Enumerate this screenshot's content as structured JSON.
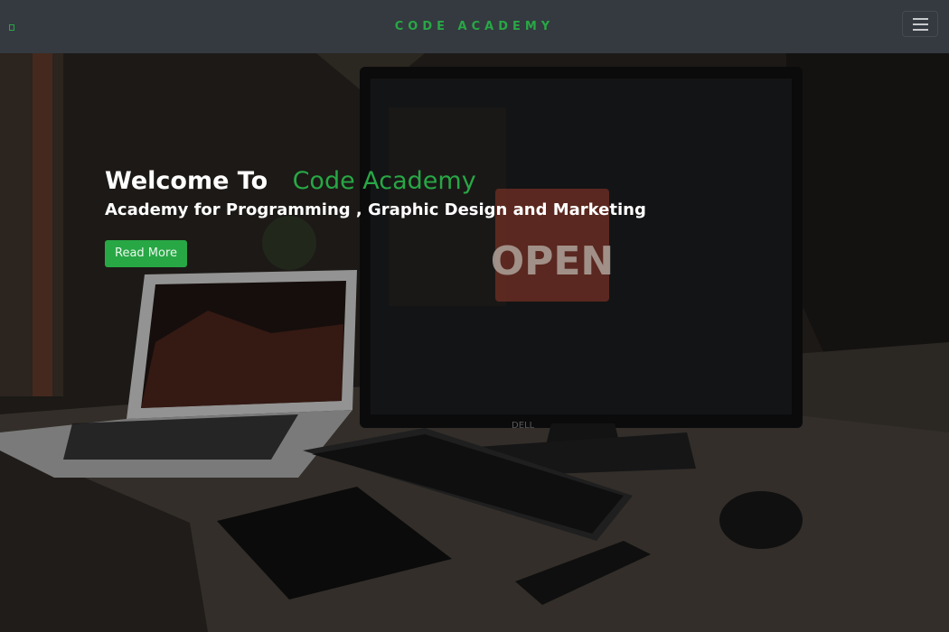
{
  "navbar": {
    "brand": "CODE ACADEMY",
    "left_icon": "broken-image-icon",
    "toggler_icon": "hamburger-menu-icon",
    "brand_color": "#28a745",
    "bg_color": "#343a40"
  },
  "hero": {
    "title_prefix": "Welcome To",
    "title_accent": "Code Academy",
    "subtitle": "Academy for Programming , Graphic Design and Marketing",
    "button_label": "Read More",
    "accent_color": "#28a745",
    "sign_text": "OPEN",
    "monitor_brand": "DELL"
  }
}
